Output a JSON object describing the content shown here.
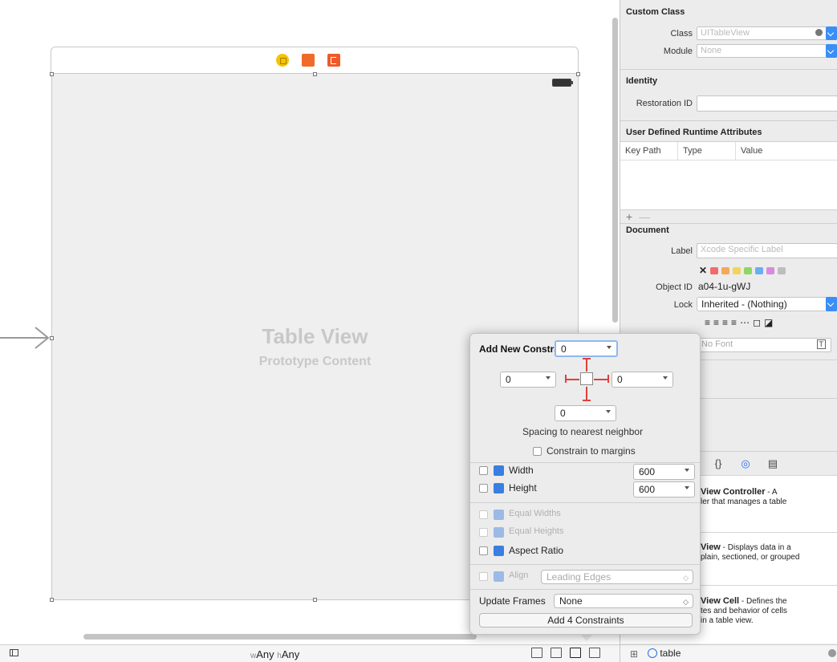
{
  "canvas": {
    "table_view_title": "Table View",
    "table_view_subtitle": "Prototype Content",
    "size_class": {
      "w_prefix": "w",
      "w_value": "Any",
      "h_prefix": "h",
      "h_value": "Any"
    },
    "icons": [
      "view-controller-icon",
      "first-responder-icon",
      "exit-icon"
    ]
  },
  "inspector": {
    "custom_class": {
      "title": "Custom Class",
      "class_label": "Class",
      "class_placeholder": "UITableView",
      "module_label": "Module",
      "module_placeholder": "None"
    },
    "identity": {
      "title": "Identity",
      "restoration_label": "Restoration ID"
    },
    "runtime_attrs": {
      "title": "User Defined Runtime Attributes",
      "columns": [
        "Key Path",
        "Type",
        "Value"
      ],
      "add_symbol": "+",
      "remove_symbol": "—"
    },
    "document": {
      "title": "Document",
      "label_label": "Label",
      "label_placeholder": "Xcode Specific Label",
      "clear_symbol": "✕",
      "colors": [
        "#f26b6b",
        "#f5a85a",
        "#f2d45a",
        "#8dd66a",
        "#6aaef2",
        "#d98ae0",
        "#bdbdbd"
      ],
      "object_id_label": "Object ID",
      "object_id_value": "a04-1u-gWJ",
      "lock_label": "Lock",
      "lock_value": "Inherited - (Nothing)",
      "font_placeholder": "No Font"
    }
  },
  "library": {
    "tabs": [
      "{}",
      "◎",
      "▤"
    ],
    "items": [
      {
        "title": "View Controller",
        "desc": " - A",
        "line2": "ler that manages a table"
      },
      {
        "title": "View",
        "desc": " - Displays data in a",
        "line2": "plain, sectioned, or grouped"
      },
      {
        "title": "View Cell",
        "desc": " - Defines the",
        "line2": "tes and behavior of cells",
        "line3": "in a table view."
      }
    ],
    "filter_value": "table"
  },
  "constraints_popover": {
    "title": "Add New Constraints",
    "top": "0",
    "left": "0",
    "right": "0",
    "bottom": "0",
    "spacing_label": "Spacing to nearest neighbor",
    "margins_label": "Constrain to margins",
    "width_label": "Width",
    "width_value": "600",
    "height_label": "Height",
    "height_value": "600",
    "equal_widths_label": "Equal Widths",
    "equal_heights_label": "Equal Heights",
    "aspect_label": "Aspect Ratio",
    "align_label": "Align",
    "align_value": "Leading Edges",
    "update_frames_label": "Update Frames",
    "update_frames_value": "None",
    "add_button": "Add 4 Constraints"
  }
}
